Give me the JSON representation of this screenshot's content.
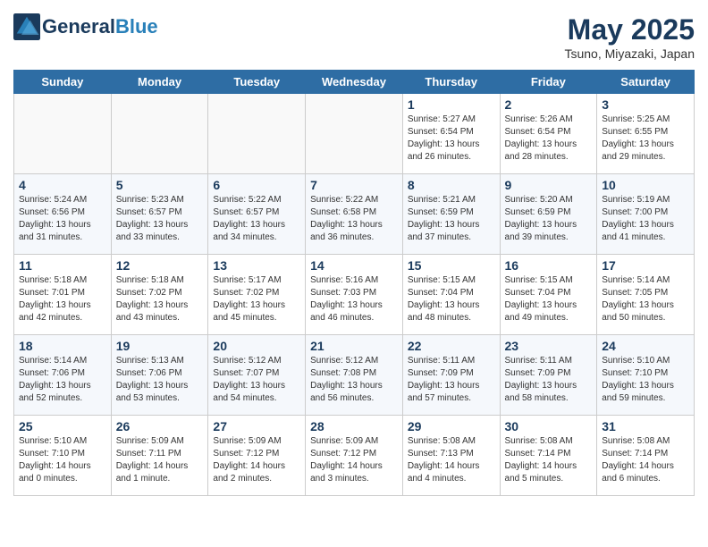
{
  "header": {
    "logo_line1": "General",
    "logo_line2": "Blue",
    "month": "May 2025",
    "location": "Tsuno, Miyazaki, Japan"
  },
  "weekdays": [
    "Sunday",
    "Monday",
    "Tuesday",
    "Wednesday",
    "Thursday",
    "Friday",
    "Saturday"
  ],
  "weeks": [
    [
      {
        "day": "",
        "info": ""
      },
      {
        "day": "",
        "info": ""
      },
      {
        "day": "",
        "info": ""
      },
      {
        "day": "",
        "info": ""
      },
      {
        "day": "1",
        "info": "Sunrise: 5:27 AM\nSunset: 6:54 PM\nDaylight: 13 hours\nand 26 minutes."
      },
      {
        "day": "2",
        "info": "Sunrise: 5:26 AM\nSunset: 6:54 PM\nDaylight: 13 hours\nand 28 minutes."
      },
      {
        "day": "3",
        "info": "Sunrise: 5:25 AM\nSunset: 6:55 PM\nDaylight: 13 hours\nand 29 minutes."
      }
    ],
    [
      {
        "day": "4",
        "info": "Sunrise: 5:24 AM\nSunset: 6:56 PM\nDaylight: 13 hours\nand 31 minutes."
      },
      {
        "day": "5",
        "info": "Sunrise: 5:23 AM\nSunset: 6:57 PM\nDaylight: 13 hours\nand 33 minutes."
      },
      {
        "day": "6",
        "info": "Sunrise: 5:22 AM\nSunset: 6:57 PM\nDaylight: 13 hours\nand 34 minutes."
      },
      {
        "day": "7",
        "info": "Sunrise: 5:22 AM\nSunset: 6:58 PM\nDaylight: 13 hours\nand 36 minutes."
      },
      {
        "day": "8",
        "info": "Sunrise: 5:21 AM\nSunset: 6:59 PM\nDaylight: 13 hours\nand 37 minutes."
      },
      {
        "day": "9",
        "info": "Sunrise: 5:20 AM\nSunset: 6:59 PM\nDaylight: 13 hours\nand 39 minutes."
      },
      {
        "day": "10",
        "info": "Sunrise: 5:19 AM\nSunset: 7:00 PM\nDaylight: 13 hours\nand 41 minutes."
      }
    ],
    [
      {
        "day": "11",
        "info": "Sunrise: 5:18 AM\nSunset: 7:01 PM\nDaylight: 13 hours\nand 42 minutes."
      },
      {
        "day": "12",
        "info": "Sunrise: 5:18 AM\nSunset: 7:02 PM\nDaylight: 13 hours\nand 43 minutes."
      },
      {
        "day": "13",
        "info": "Sunrise: 5:17 AM\nSunset: 7:02 PM\nDaylight: 13 hours\nand 45 minutes."
      },
      {
        "day": "14",
        "info": "Sunrise: 5:16 AM\nSunset: 7:03 PM\nDaylight: 13 hours\nand 46 minutes."
      },
      {
        "day": "15",
        "info": "Sunrise: 5:15 AM\nSunset: 7:04 PM\nDaylight: 13 hours\nand 48 minutes."
      },
      {
        "day": "16",
        "info": "Sunrise: 5:15 AM\nSunset: 7:04 PM\nDaylight: 13 hours\nand 49 minutes."
      },
      {
        "day": "17",
        "info": "Sunrise: 5:14 AM\nSunset: 7:05 PM\nDaylight: 13 hours\nand 50 minutes."
      }
    ],
    [
      {
        "day": "18",
        "info": "Sunrise: 5:14 AM\nSunset: 7:06 PM\nDaylight: 13 hours\nand 52 minutes."
      },
      {
        "day": "19",
        "info": "Sunrise: 5:13 AM\nSunset: 7:06 PM\nDaylight: 13 hours\nand 53 minutes."
      },
      {
        "day": "20",
        "info": "Sunrise: 5:12 AM\nSunset: 7:07 PM\nDaylight: 13 hours\nand 54 minutes."
      },
      {
        "day": "21",
        "info": "Sunrise: 5:12 AM\nSunset: 7:08 PM\nDaylight: 13 hours\nand 56 minutes."
      },
      {
        "day": "22",
        "info": "Sunrise: 5:11 AM\nSunset: 7:09 PM\nDaylight: 13 hours\nand 57 minutes."
      },
      {
        "day": "23",
        "info": "Sunrise: 5:11 AM\nSunset: 7:09 PM\nDaylight: 13 hours\nand 58 minutes."
      },
      {
        "day": "24",
        "info": "Sunrise: 5:10 AM\nSunset: 7:10 PM\nDaylight: 13 hours\nand 59 minutes."
      }
    ],
    [
      {
        "day": "25",
        "info": "Sunrise: 5:10 AM\nSunset: 7:10 PM\nDaylight: 14 hours\nand 0 minutes."
      },
      {
        "day": "26",
        "info": "Sunrise: 5:09 AM\nSunset: 7:11 PM\nDaylight: 14 hours\nand 1 minute."
      },
      {
        "day": "27",
        "info": "Sunrise: 5:09 AM\nSunset: 7:12 PM\nDaylight: 14 hours\nand 2 minutes."
      },
      {
        "day": "28",
        "info": "Sunrise: 5:09 AM\nSunset: 7:12 PM\nDaylight: 14 hours\nand 3 minutes."
      },
      {
        "day": "29",
        "info": "Sunrise: 5:08 AM\nSunset: 7:13 PM\nDaylight: 14 hours\nand 4 minutes."
      },
      {
        "day": "30",
        "info": "Sunrise: 5:08 AM\nSunset: 7:14 PM\nDaylight: 14 hours\nand 5 minutes."
      },
      {
        "day": "31",
        "info": "Sunrise: 5:08 AM\nSunset: 7:14 PM\nDaylight: 14 hours\nand 6 minutes."
      }
    ]
  ]
}
